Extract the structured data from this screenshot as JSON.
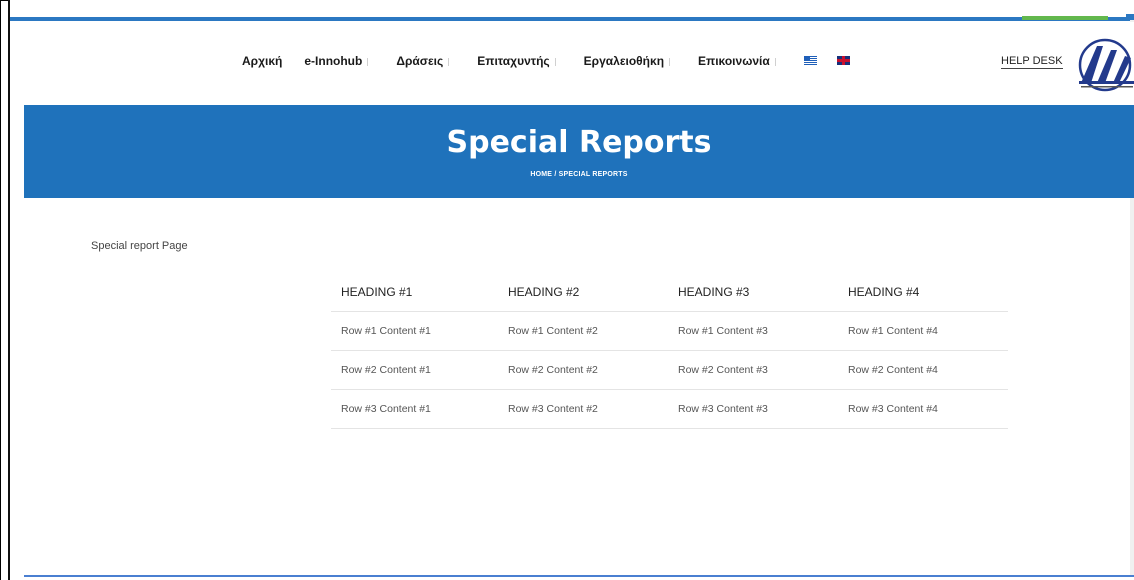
{
  "nav": {
    "items": [
      {
        "label": "Αρχική",
        "has_caret": false
      },
      {
        "label": "e-Innohub",
        "has_caret": true
      },
      {
        "label": "Δράσεις",
        "has_caret": true
      },
      {
        "label": "Επιταχυντής",
        "has_caret": true
      },
      {
        "label": "Εργαλειοθήκη",
        "has_caret": true
      },
      {
        "label": "Επικοινωνία",
        "has_caret": true
      }
    ],
    "flags": [
      "greek-flag-icon",
      "uk-flag-icon"
    ],
    "helpdesk": "HELP DESK"
  },
  "banner": {
    "title": "Special Reports",
    "breadcrumb": "HOME  /  SPECIAL REPORTS"
  },
  "content": {
    "page_text": "Special report Page",
    "table": {
      "headers": [
        "HEADING #1",
        "HEADING #2",
        "HEADING #3",
        "HEADING #4"
      ],
      "rows": [
        [
          "Row #1 Content #1",
          "Row #1 Content #2",
          "Row #1 Content #3",
          "Row #1 Content #4"
        ],
        [
          "Row #2 Content #1",
          "Row #2 Content #2",
          "Row #2 Content #3",
          "Row #2 Content #4"
        ],
        [
          "Row #3 Content #1",
          "Row #3 Content #2",
          "Row #3 Content #3",
          "Row #3 Content #4"
        ]
      ]
    }
  },
  "colors": {
    "banner": "#1f72bb",
    "accent_green": "#63b84d",
    "text_dark": "#1a1a1a"
  }
}
